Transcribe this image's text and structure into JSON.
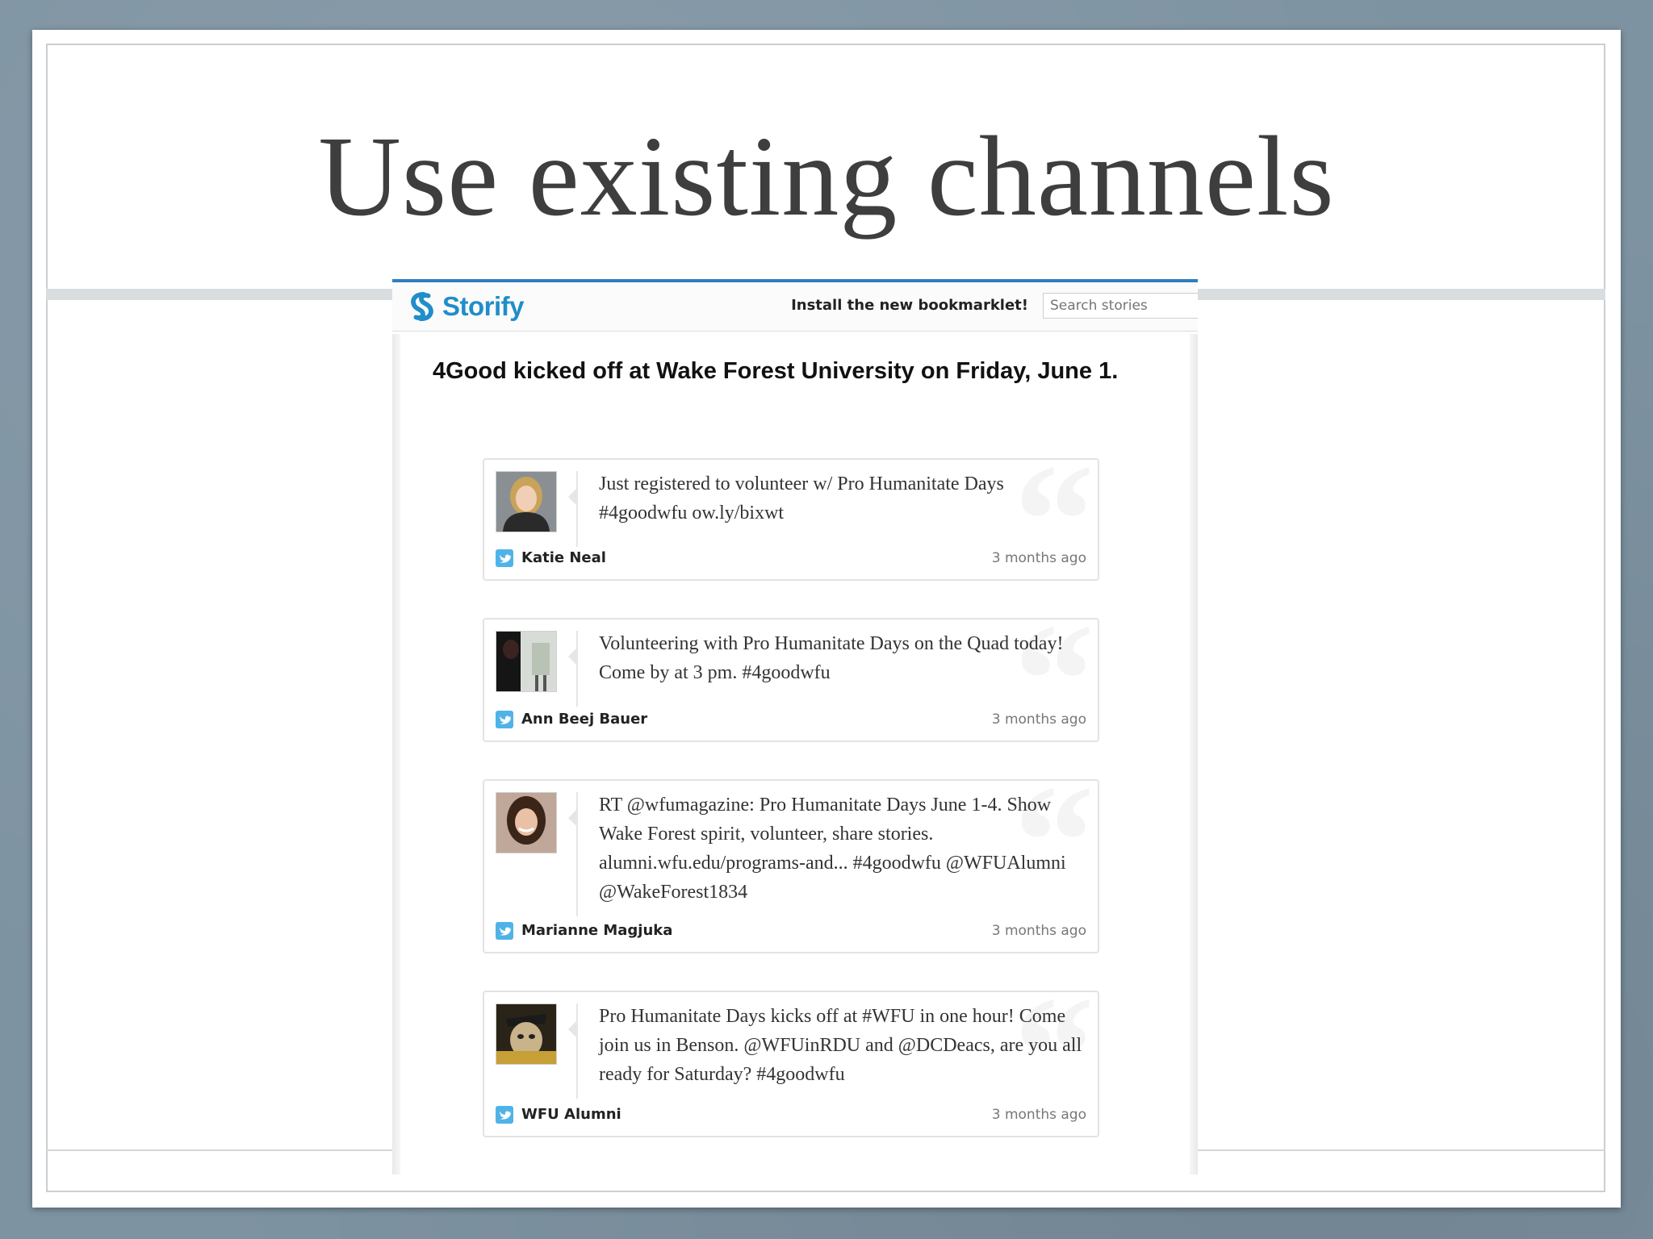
{
  "slide": {
    "title": "Use existing channels"
  },
  "storify": {
    "logo_text": "Storify",
    "bookmarklet_label": "Install the new bookmarklet!",
    "search_placeholder": "Search stories",
    "story_heading": "4Good kicked off at Wake Forest University on Friday, June 1.",
    "tweets": [
      {
        "text": "Just registered to volunteer w/ Pro Humanitate Days #4goodwfu ow.ly/bixwt",
        "author": "Katie Neal",
        "time": "3 months ago"
      },
      {
        "text": "Volunteering with Pro Humanitate Days on the Quad today! Come by at 3 pm. #4goodwfu",
        "author": "Ann Beej Bauer",
        "time": "3 months ago"
      },
      {
        "text": "RT @wfumagazine: Pro Humanitate Days June 1-4. Show Wake Forest spirit, volunteer, share stories. alumni.wfu.edu/programs-and... #4goodwfu @WFUAlumni @WakeForest1834",
        "author": "Marianne Magjuka",
        "time": "3 months ago"
      },
      {
        "text": "Pro Humanitate Days kicks off at #WFU in one hour! Come join us in Benson. @WFUinRDU and @DCDeacs, are you all ready for Saturday? #4goodwfu",
        "author": "WFU Alumni",
        "time": "3 months ago"
      }
    ]
  },
  "colors": {
    "brand": "#1f8ec9",
    "header_accent": "#2f7fc1",
    "twitter": "#4fb3e8"
  },
  "icons": {
    "logo": "storify-logo-icon",
    "source": "twitter-bird-icon"
  }
}
